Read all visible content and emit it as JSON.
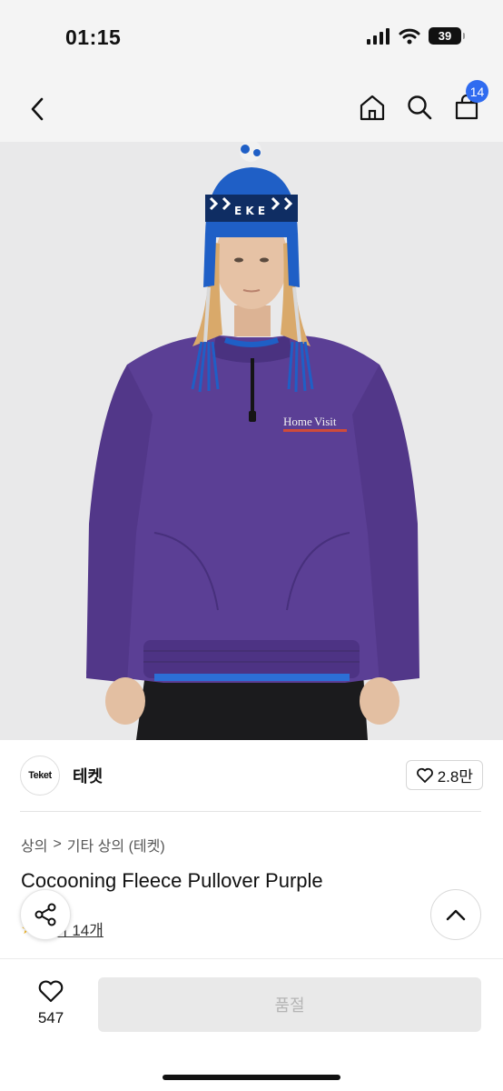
{
  "status_bar": {
    "time": "01:15",
    "battery": "39"
  },
  "nav": {
    "cart_count": "14"
  },
  "product_image": {
    "patch_line1": "Home",
    "patch_line2": "Visit",
    "hat_text": "E K E"
  },
  "brand": {
    "logo_text": "Teket",
    "name": "테켓",
    "likes": "2.8만"
  },
  "breadcrumb": {
    "level1": "상의",
    "separator": ">",
    "level2": "기타 상의 (테켓)"
  },
  "product": {
    "title": "Cocooning Fleece Pullover Purple",
    "review_link": "후기 14개"
  },
  "bottom_bar": {
    "wish_count": "547",
    "action_label": "품절"
  },
  "colors": {
    "accent": "#2f6bf0",
    "sweater": "#5b3f95",
    "hat": "#1f5fc6",
    "star": "#f3b31b"
  }
}
